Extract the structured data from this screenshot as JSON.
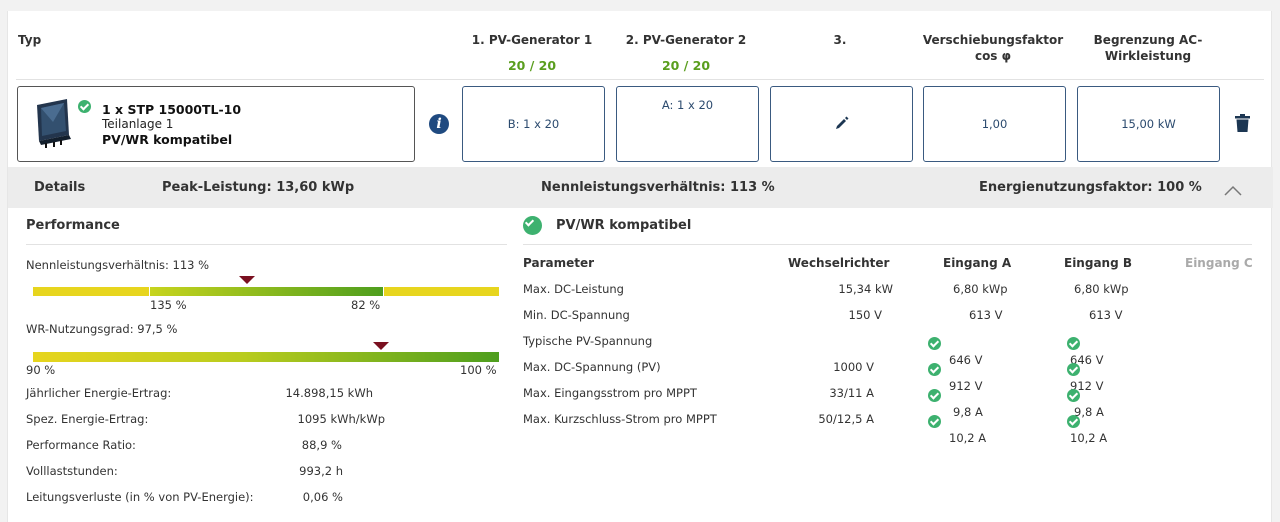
{
  "columns": {
    "typ": "Typ",
    "gen1": "1. PV-Generator 1",
    "gen1_val": "20 / 20",
    "gen2": "2. PV-Generator 2",
    "gen2_val": "20 / 20",
    "gen3": "3.",
    "cos_1": "Verschiebungsfaktor",
    "cos_2": "cos φ",
    "ac_1": "Begrenzung AC-",
    "ac_2": "Wirkleistung"
  },
  "inverter": {
    "name": "1 x STP 15000TL-10",
    "sub": "Teilanlage 1",
    "status": "PV/WR kompatibel"
  },
  "boxes": {
    "gen1": "B: 1 x 20",
    "gen2": "A: 1 x 20",
    "cos": "1,00",
    "ac": "15,00 kW"
  },
  "summary": {
    "details": "Details",
    "peak": "Peak-Leistung: 13,60 kWp",
    "ratio": "Nennleistungsverhältnis: 113 %",
    "usage": "Energienutzungsfaktor: 100 %"
  },
  "performance": {
    "title": "Performance",
    "nlv_label": "Nennleistungsverhältnis: 113 %",
    "nlv_bar_left": "135 %",
    "nlv_bar_right": "82 %",
    "wr_label": "WR-Nutzungsgrad: 97,5 %",
    "wr_bar_left": "90 %",
    "wr_bar_right": "100 %",
    "rows": [
      {
        "label": "Jährlicher Energie-Ertrag:",
        "value": "14.898,15 kWh"
      },
      {
        "label": "Spez. Energie-Ertrag:",
        "value": "1095 kWh/kWp"
      },
      {
        "label": "Performance Ratio:",
        "value": "88,9 %"
      },
      {
        "label": "Volllaststunden:",
        "value": "993,2 h"
      },
      {
        "label": "Leitungsverluste (in % von PV-Energie):",
        "value": "0,06 %"
      }
    ]
  },
  "compat": {
    "title": "PV/WR kompatibel",
    "headers": {
      "param": "Parameter",
      "wr": "Wechselrichter",
      "a": "Eingang A",
      "b": "Eingang B",
      "c": "Eingang C"
    },
    "rows": [
      {
        "param": "Max. DC-Leistung",
        "wr": "15,34 kW",
        "a": "6,80 kWp",
        "b": "6,80 kWp",
        "check": false
      },
      {
        "param": "Min. DC-Spannung",
        "wr": "150 V",
        "a": "613 V",
        "b": "613 V",
        "check": false
      },
      {
        "param": "Typische PV-Spannung",
        "wr": "",
        "a": "646 V",
        "b": "646 V",
        "check": true
      },
      {
        "param": "Max. DC-Spannung (PV)",
        "wr": "1000 V",
        "a": "912 V",
        "b": "912 V",
        "check": true
      },
      {
        "param": "Max. Eingangsstrom pro MPPT",
        "wr": "33/11 A",
        "a": "9,8 A",
        "b": "9,8 A",
        "check": true
      },
      {
        "param": "Max. Kurzschluss-Strom pro MPPT",
        "wr": "50/12,5 A",
        "a": "10,2 A",
        "b": "10,2 A",
        "check": true
      }
    ]
  },
  "colors": {
    "accent": "#2b4a6e",
    "ok": "#3db16f",
    "green": "#5a9e1e",
    "marker": "#7a1020"
  }
}
